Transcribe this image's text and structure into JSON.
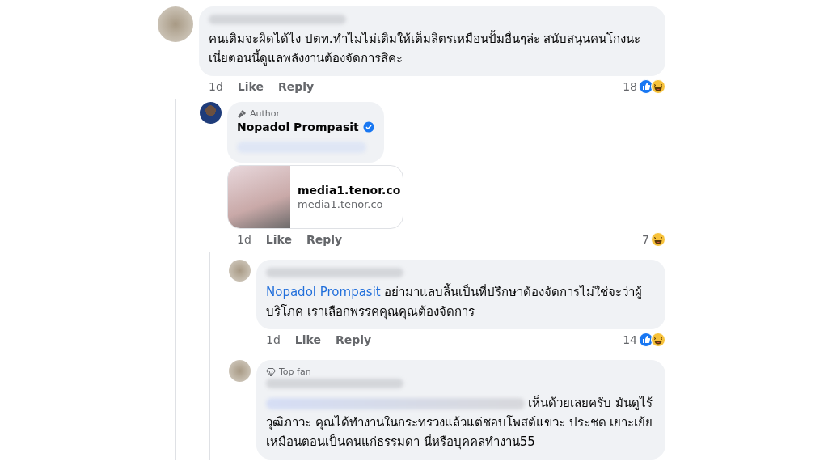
{
  "comments": [
    {
      "avatar": {
        "kind": "blurred"
      },
      "name_blurred": true,
      "text": "คนเติมจะผิดได้ไง ปตท.ทำไมไม่เติมให้เต็มลิตรเหมือนปั้มอื่นๆล่ะ สนับสนุนคนโกงนะ เนี่ยตอนนี้ดูแลพลังงานต้องจัดการสิคะ",
      "meta": {
        "time": "1d",
        "like": "Like",
        "reply": "Reply",
        "count": "18",
        "reactions": [
          {
            "kind": "like"
          },
          {
            "kind": "haha"
          }
        ]
      },
      "children": [
        {
          "avatar": {
            "kind": "photo"
          },
          "badge": {
            "kind": "author",
            "label": "Author"
          },
          "name": "Nopadol Prompasit",
          "verified": true,
          "text_blurred": true,
          "link_preview": {
            "title": "media1.tenor.co",
            "domain": "media1.tenor.co"
          },
          "meta": {
            "time": "1d",
            "like": "Like",
            "reply": "Reply",
            "count": "7",
            "reactions": [
              {
                "kind": "haha"
              }
            ]
          },
          "children": [
            {
              "avatar": {
                "kind": "blurred"
              },
              "name_blurred": true,
              "mention": "Nopadol Prompasit",
              "text": "อย่ามาแลบลิ้นเป็นที่ปรึกษาต้องจัดการไม่ใช่จะว่าผู้บริโภค เราเลือกพรรคคุณคุณต้องจัดการ",
              "meta": {
                "time": "1d",
                "like": "Like",
                "reply": "Reply",
                "count": "14",
                "reactions": [
                  {
                    "kind": "like"
                  },
                  {
                    "kind": "haha"
                  }
                ]
              }
            },
            {
              "avatar": {
                "kind": "blurred"
              },
              "badge": {
                "kind": "top_fan",
                "label": "Top fan"
              },
              "name_blurred": true,
              "mention_blurred": true,
              "text": "เห็นด้วยเลยครับ มันดูไร้วุฒิภาวะ คุณได้ทำงานในกระทรวงแล้วแต่ชอบโพสต์แขวะ ประชด เยาะเย้ยเหมือนตอนเป็นคนแก่ธรรมดา นี่หรือบุคคลทำงาน55"
            }
          ]
        }
      ]
    }
  ]
}
